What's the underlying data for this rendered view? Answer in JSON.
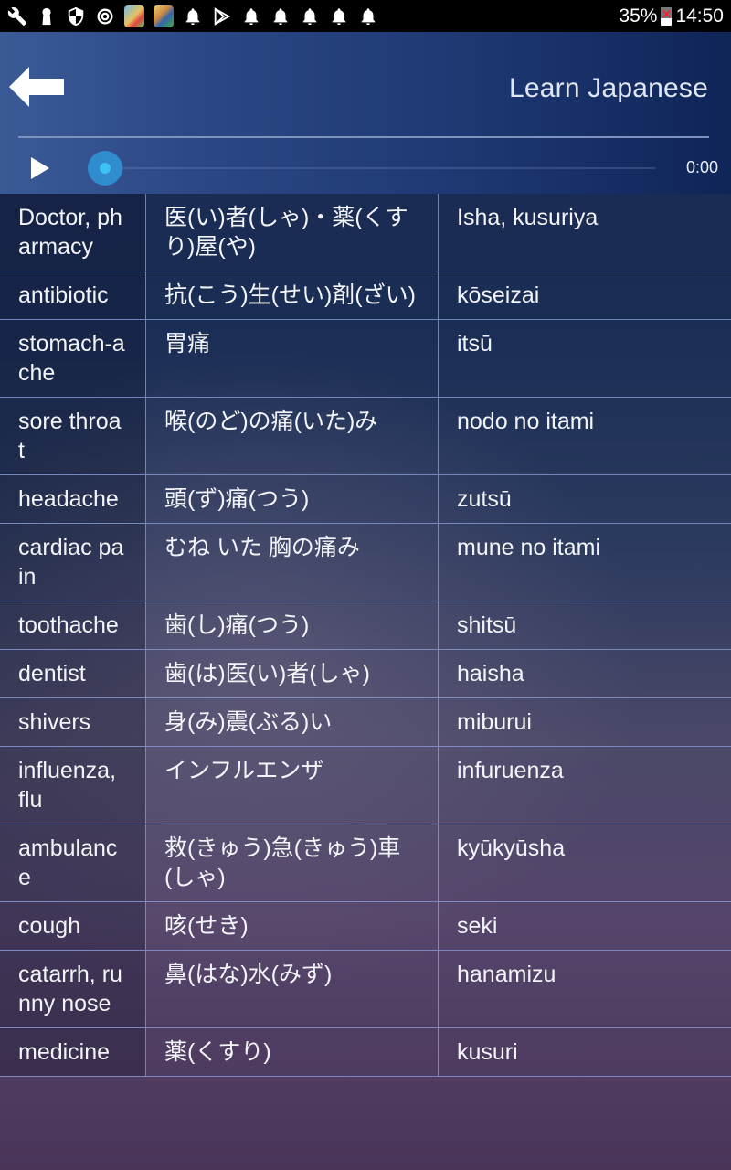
{
  "status_bar": {
    "left_icons": [
      "wrench-icon",
      "keyhole-icon",
      "shield-icon",
      "sync-icon",
      "app-thumbnail-1",
      "app-thumbnail-2",
      "bell-icon",
      "play-store-icon",
      "bell-icon",
      "bell-icon",
      "bell-icon",
      "bell-icon",
      "bell-icon"
    ],
    "battery_percent": "35%",
    "time": "14:50"
  },
  "header": {
    "back_icon": "back-arrow-icon",
    "title": "Learn Japanese"
  },
  "player": {
    "play_icon": "play-icon",
    "progress": 0,
    "time": "0:00"
  },
  "rows": [
    {
      "english": "Doctor, pharmacy",
      "japanese": "医(い)者(しゃ)・薬(くすり)屋(や)",
      "romaji": "Isha, kusuriya"
    },
    {
      "english": "antibiotic",
      "japanese": "抗(こう)生(せい)剤(ざい)",
      "romaji": "kōseizai"
    },
    {
      "english": "stomach-ache",
      "japanese": "胃痛",
      "romaji": "itsū"
    },
    {
      "english": "sore throat",
      "japanese": "喉(のど)の痛(いた)み",
      "romaji": "nodo no itami"
    },
    {
      "english": "headache",
      "japanese": "頭(ず)痛(つう)",
      "romaji": "zutsū"
    },
    {
      "english": "cardiac pain",
      "japanese": "むね いた 胸の痛み",
      "romaji": "mune no itami"
    },
    {
      "english": "toothache",
      "japanese": "歯(し)痛(つう)",
      "romaji": "shitsū"
    },
    {
      "english": "dentist",
      "japanese": "歯(は)医(い)者(しゃ)",
      "romaji": "haisha"
    },
    {
      "english": "shivers",
      "japanese": "身(み)震(ぶる)い",
      "romaji": "miburui"
    },
    {
      "english": "influenza, flu",
      "japanese": "インフルエンザ",
      "romaji": "infuruenza"
    },
    {
      "english": "ambulance",
      "japanese": "救(きゅう)急(きゅう)車(しゃ)",
      "romaji": "kyūkyūsha"
    },
    {
      "english": "cough",
      "japanese": "咳(せき)",
      "romaji": "seki"
    },
    {
      "english": "catarrh, runny nose",
      "japanese": "鼻(はな)水(みず)",
      "romaji": "hanamizu"
    },
    {
      "english": "medicine",
      "japanese": "薬(くすり)",
      "romaji": "kusuri"
    }
  ]
}
